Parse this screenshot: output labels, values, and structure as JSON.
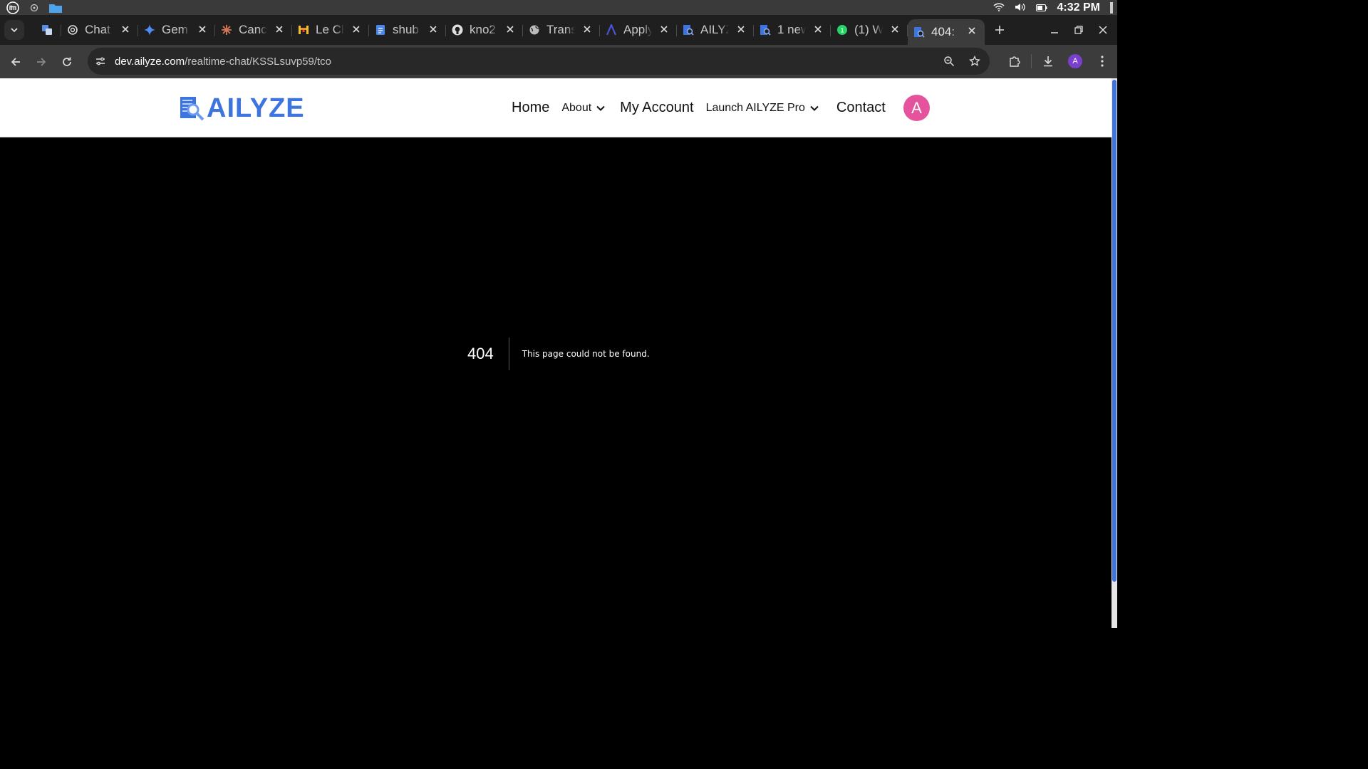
{
  "os": {
    "time": "4:32 PM"
  },
  "tabs": [
    {
      "title": "",
      "icon": "translate-icon",
      "color": "#5a8de0"
    },
    {
      "title": "Chat",
      "icon": "chatgpt-icon",
      "color": "#d0d0d0"
    },
    {
      "title": "Gem",
      "icon": "gemini-icon",
      "color": "#4c8df6"
    },
    {
      "title": "Canc",
      "icon": "claude-icon",
      "color": "#d97757"
    },
    {
      "title": "Le Cl",
      "icon": "mistral-icon",
      "color": "#f28c28"
    },
    {
      "title": "shub",
      "icon": "google-docs-icon",
      "color": "#4a86e8"
    },
    {
      "title": "kno2",
      "icon": "github-icon",
      "color": "#e0e0e0"
    },
    {
      "title": "Trans",
      "icon": "globe-icon",
      "color": "#bbbbbb"
    },
    {
      "title": "Apply",
      "icon": "apply-logo-icon",
      "color": "#4a54d8"
    },
    {
      "title": "AILYZ",
      "icon": "ailyze-icon",
      "color": "#3d74e0"
    },
    {
      "title": "1 new",
      "icon": "ailyze-icon",
      "color": "#3d74e0"
    },
    {
      "title": "(1) W",
      "icon": "whatsapp-icon",
      "color": "#25d366"
    },
    {
      "title": "404:",
      "icon": "ailyze-icon",
      "color": "#3d74e0",
      "active": true
    }
  ],
  "toolbar": {
    "url_host": "dev.ailyze.com",
    "url_path": "/realtime-chat/KSSLsuvp59/tco",
    "profile_initial": "A"
  },
  "site": {
    "logo_text": "AILYZE",
    "nav": {
      "home": "Home",
      "about": "About",
      "my_account": "My Account",
      "launch": "Launch AILYZE Pro",
      "contact": "Contact"
    },
    "avatar_initial": "A"
  },
  "error": {
    "code": "404",
    "message": "This page could not be found."
  },
  "colors": {
    "brand": "#3d74e0",
    "avatar": "#e5539c",
    "page_bg": "#000000"
  }
}
